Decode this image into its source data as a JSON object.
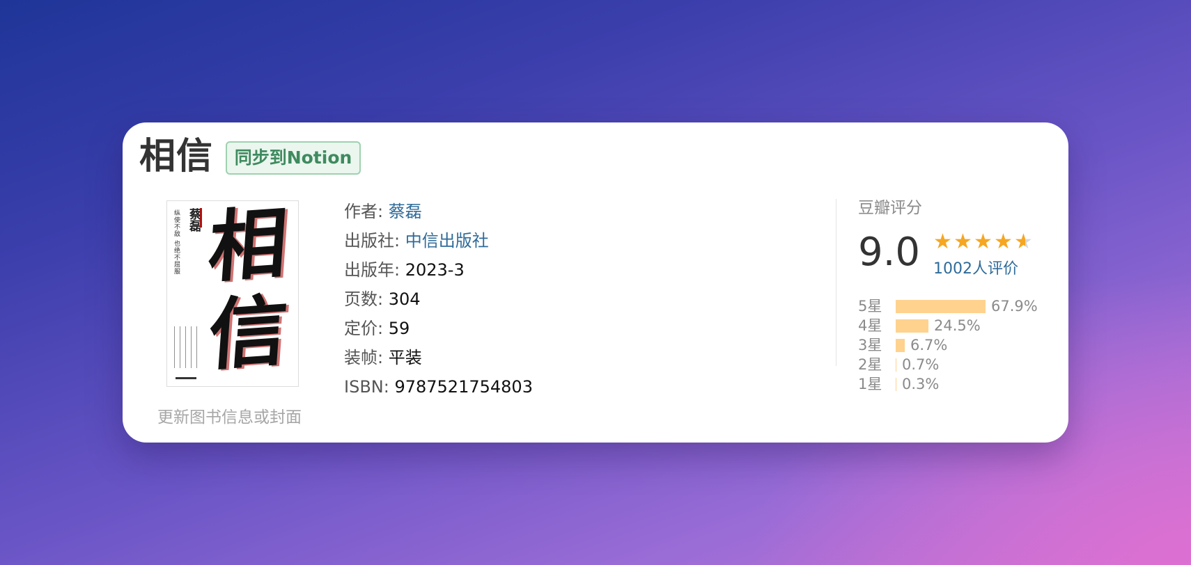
{
  "book": {
    "title": "相信",
    "sync_button": "同步到Notion",
    "update_link": "更新图书信息或封面",
    "cover": {
      "title": "相信",
      "author": "蔡磊"
    },
    "info": [
      {
        "label": "作者: ",
        "value": "蔡磊",
        "link": true
      },
      {
        "label": "出版社: ",
        "value": "中信出版社",
        "link": true
      },
      {
        "label": "出版年: ",
        "value": "2023-3",
        "link": false
      },
      {
        "label": "页数: ",
        "value": "304",
        "link": false
      },
      {
        "label": "定价: ",
        "value": "59",
        "link": false
      },
      {
        "label": "装帧: ",
        "value": "平装",
        "link": false
      },
      {
        "label": "ISBN: ",
        "value": "9787521754803",
        "link": false
      }
    ]
  },
  "rating": {
    "title": "豆瓣评分",
    "score": "9.0",
    "stars": 4.5,
    "votes": "1002人评价",
    "distribution": [
      {
        "label": "5星",
        "percent": 67.9,
        "text": "67.9%"
      },
      {
        "label": "4星",
        "percent": 24.5,
        "text": "24.5%"
      },
      {
        "label": "3星",
        "percent": 6.7,
        "text": "6.7%"
      },
      {
        "label": "2星",
        "percent": 0.7,
        "text": "0.7%"
      },
      {
        "label": "1星",
        "percent": 0.3,
        "text": "0.3%"
      }
    ],
    "colors": {
      "star": "#f5a623",
      "bar": "#ffd28e",
      "link": "#2f6b9a"
    }
  }
}
